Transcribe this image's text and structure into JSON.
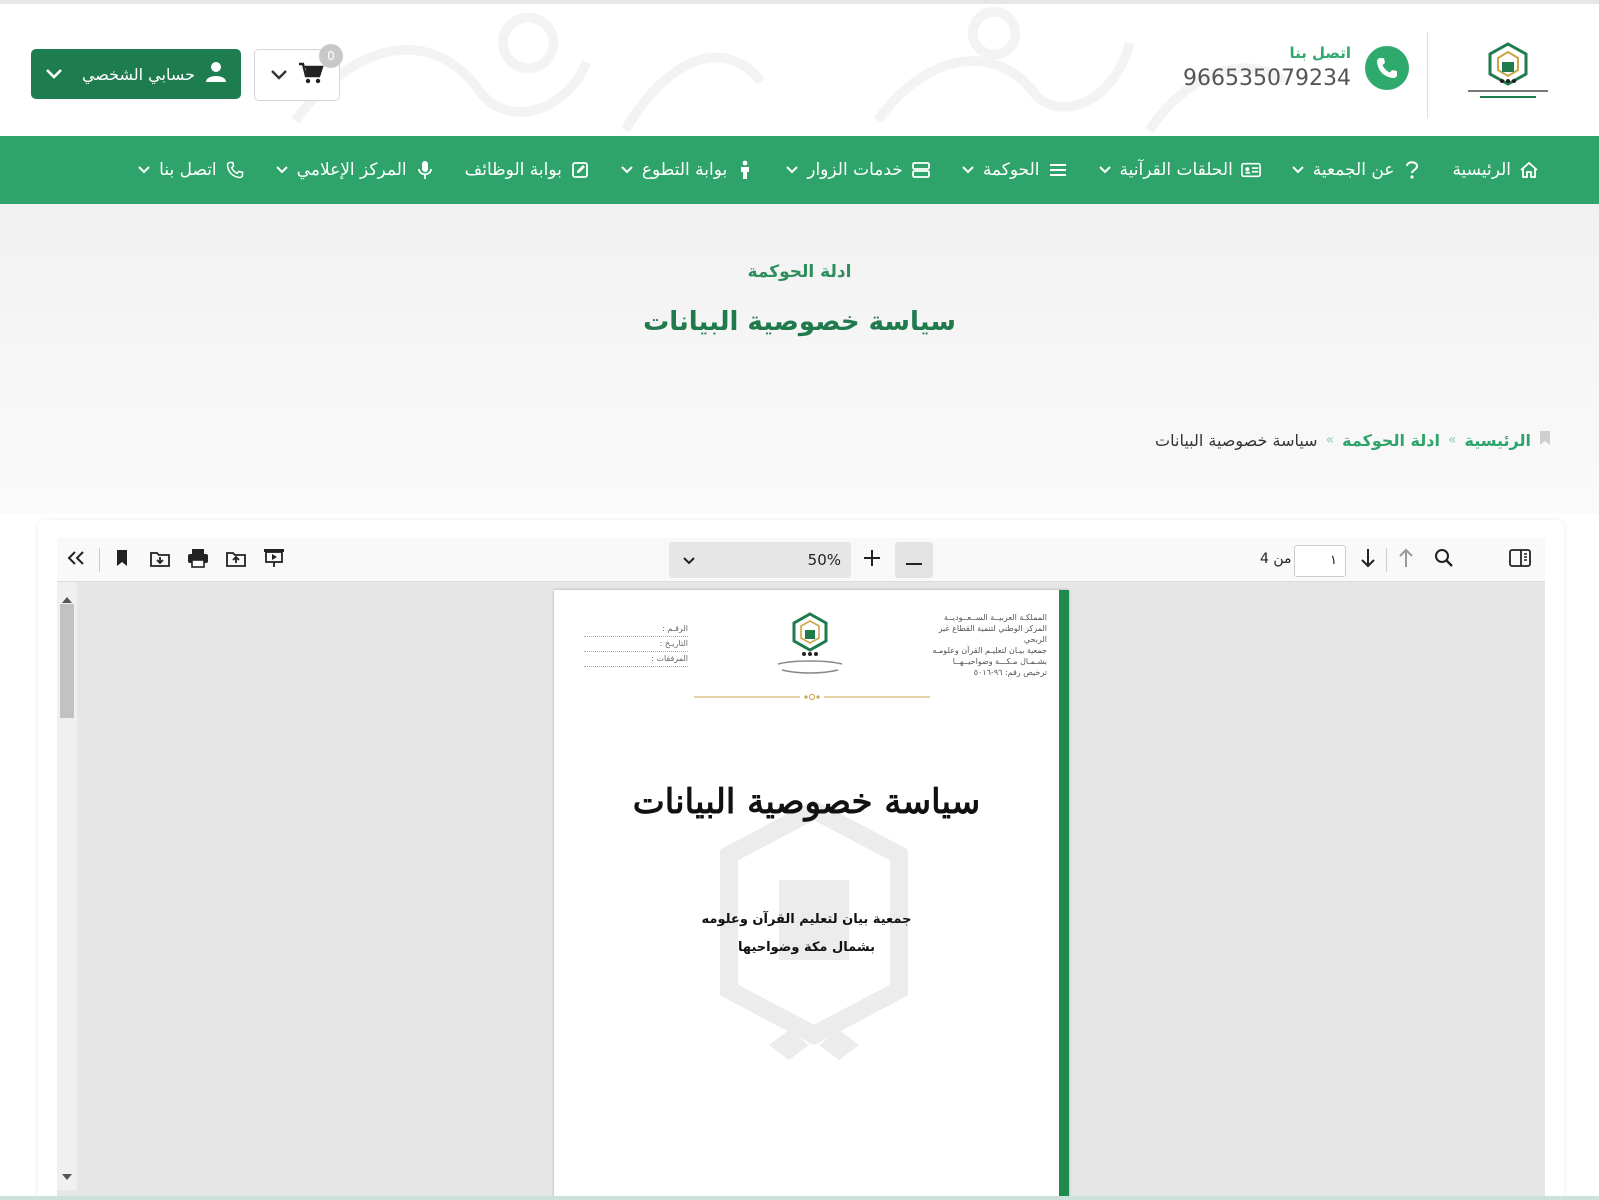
{
  "header": {
    "account_label": "حسابي الشخصي",
    "cart_count": "0",
    "contact_title": "اتصل بنا",
    "contact_phone": "966535079234"
  },
  "nav": {
    "items": [
      {
        "label": "الرئيسية",
        "icon": "home-icon"
      },
      {
        "label": "عن الجمعية",
        "icon": "question-icon"
      },
      {
        "label": "الحلقات القرآنية",
        "icon": "id-card-icon"
      },
      {
        "label": "الحوكمة",
        "icon": "list-icon"
      },
      {
        "label": "خدمات الزوار",
        "icon": "server-icon"
      },
      {
        "label": "بوابة التطوع",
        "icon": "person-icon"
      },
      {
        "label": "بوابة الوظائف",
        "icon": "edit-icon"
      },
      {
        "label": "المركز الإعلامي",
        "icon": "microphone-icon"
      },
      {
        "label": "اتصل بنا",
        "icon": "phone-icon"
      }
    ]
  },
  "hero": {
    "kicker": "ادلة الحوكمة",
    "title": "سياسة خصوصية البيانات"
  },
  "breadcrumb": {
    "home": "الرئيسية",
    "section": "ادلة الحوكمة",
    "current": "سياسة خصوصية البيانات",
    "separator": "»"
  },
  "pdf_viewer": {
    "zoom": "50%",
    "page_number": "١",
    "page_of": "من 4"
  },
  "pdf_page": {
    "header_right": [
      "المملكـة العربيــة الســعــوديــة",
      "المركز الوطني لتنمية القطاع غير الربحي",
      "جمعية بيـان لتعليـم القرآن وعلومـه",
      "بشـمـال مـكـــة وضواحيــهــا",
      "ترخيص رقم: ٩٦-٥٠١٦"
    ],
    "header_left": [
      "الرقـم :",
      "التاريـخ :",
      "المرفقات :"
    ],
    "title": "سياسة خصوصية البيانات",
    "org_line1": "جمعية بيان لتعليم القرآن وعلومه",
    "org_line2": "بشمال مكة وضواحيها"
  },
  "colors": {
    "brand_green": "#2ea46a",
    "dark_green": "#1e7d4f"
  }
}
